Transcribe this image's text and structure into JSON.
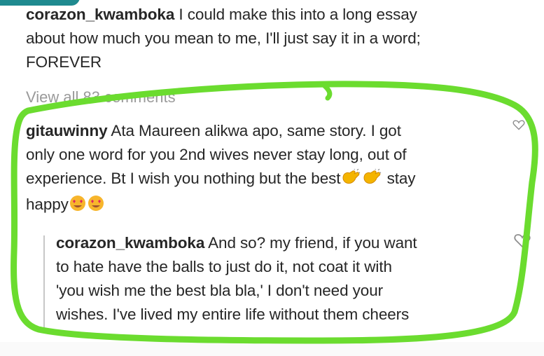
{
  "caption": {
    "username": "corazon_kwamboka",
    "text_line1": " I could make this into a long essay",
    "text_line2": "about how much you mean to me, I'll just say it in a word;",
    "text_line3": "FOREVER"
  },
  "view_all_comments": "View all 83 comments",
  "comment": {
    "username": "gitauwinny",
    "text_line1": " Ata Maureen alikwa apo, same story. I got",
    "text_line2": "only one word for you 2nd wives never stay long, out of",
    "text_line3_a": "experience. Bt I wish you nothing but the best",
    "text_line3_b": " stay",
    "text_line4": "happy"
  },
  "reply": {
    "username": "corazon_kwamboka",
    "text_line1": " And so? my friend, if you want",
    "text_line2": "to hate have the balls to just do it, not coat it with",
    "text_line3": "'you wish me the best bla bla,' I don't need your",
    "text_line4": "wishes. I've lived my entire life without them cheers"
  },
  "icons": [
    "clapping-hands-icon",
    "heart-eyes-emoji-icon",
    "heart-outline-icon"
  ],
  "colors": {
    "highlight_outline": "#6bdc2f",
    "text": "#262626",
    "muted": "#9a9a9a",
    "corner_accent": "#1f8a8f"
  }
}
